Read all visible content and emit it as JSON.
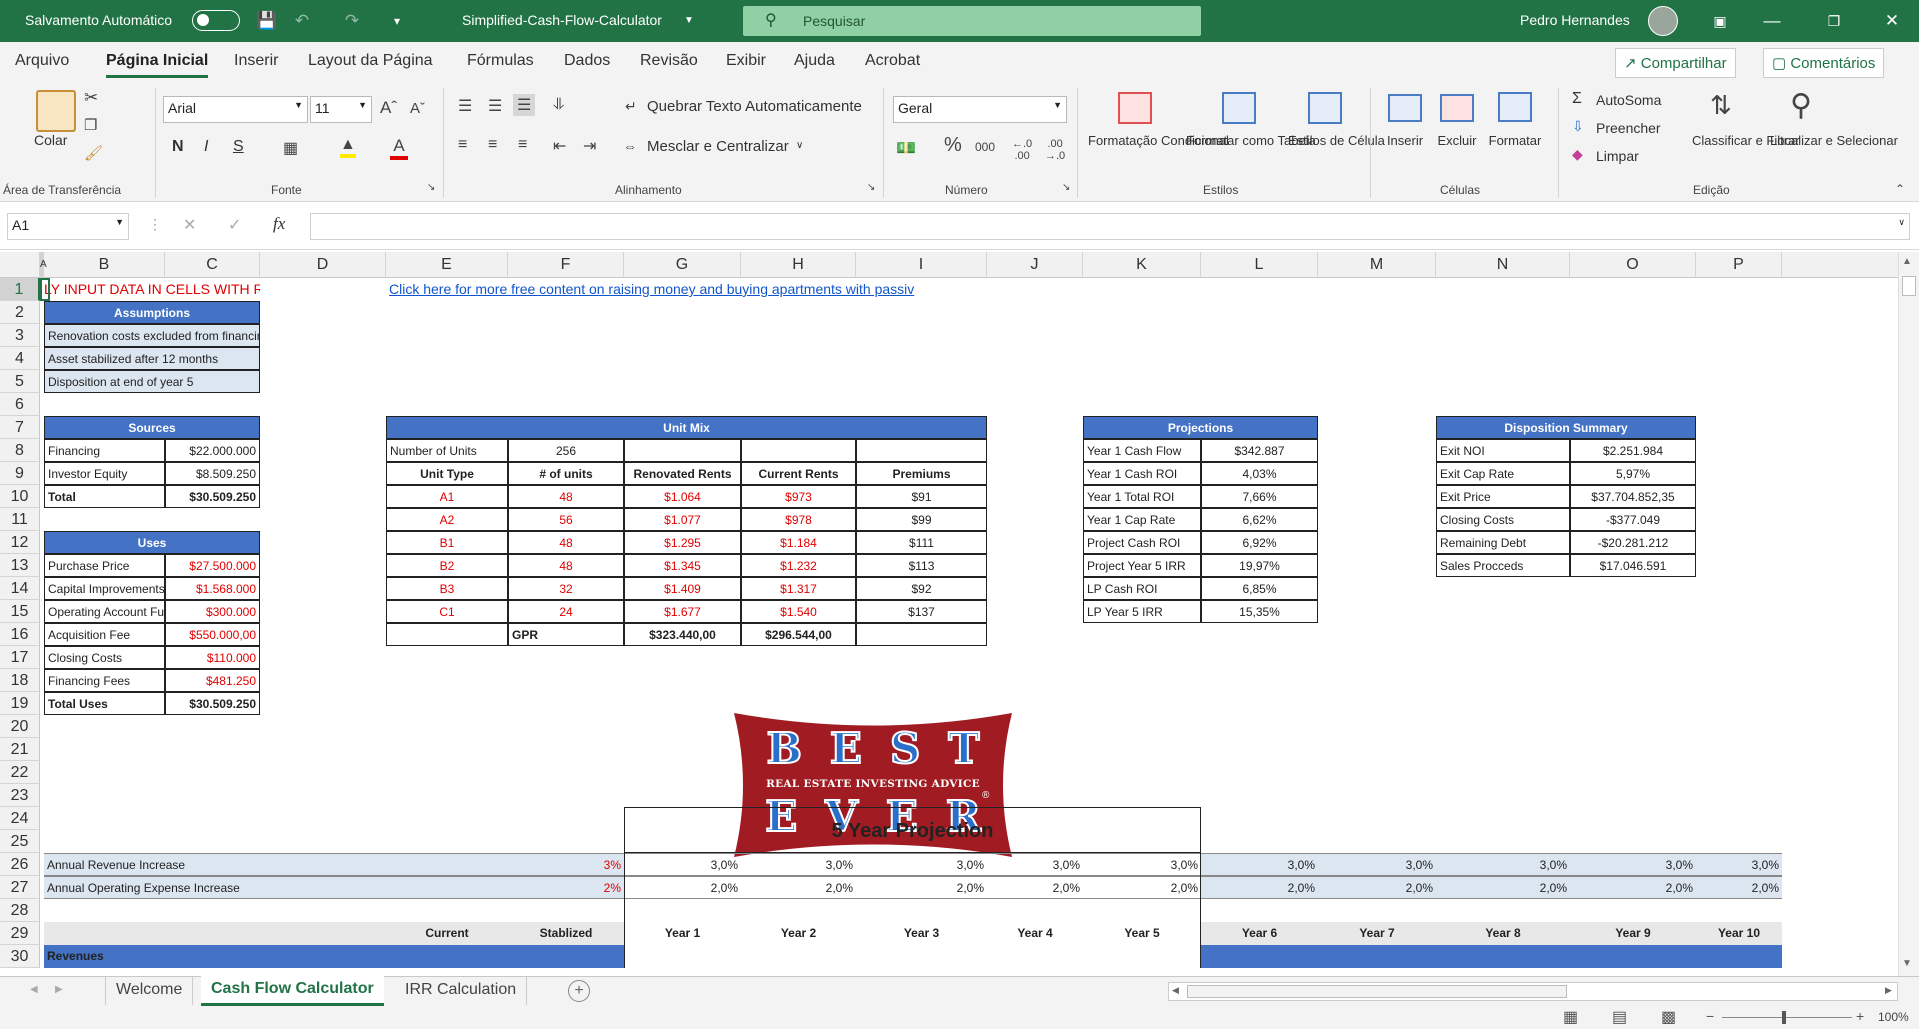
{
  "titlebar": {
    "autosave": "Salvamento Automático",
    "filename": "Simplified-Cash-Flow-Calculator",
    "search_placeholder": "Pesquisar",
    "user": "Pedro Hernandes"
  },
  "menu": {
    "tabs": [
      "Arquivo",
      "Página Inicial",
      "Inserir",
      "Layout da Página",
      "Fórmulas",
      "Dados",
      "Revisão",
      "Exibir",
      "Ajuda",
      "Acrobat"
    ],
    "share": "Compartilhar",
    "comments": "Comentários"
  },
  "ribbon": {
    "paste": "Colar",
    "clipboard_group": "Área de Transferência",
    "font_name": "Arial",
    "font_size": "11",
    "bold": "N",
    "italic": "I",
    "underline": "S",
    "font_group": "Fonte",
    "wrap_text": "Quebrar Texto Automaticamente",
    "merge_center": "Mesclar e Centralizar",
    "alignment_group": "Alinhamento",
    "number_format": "Geral",
    "number_group": "Número",
    "cond_format": "Formatação Condicional",
    "format_table": "Formatar como Tabela",
    "cell_styles": "Estilos de Célula",
    "styles_group": "Estilos",
    "insert": "Inserir",
    "delete": "Excluir",
    "format": "Formatar",
    "cells_group": "Células",
    "autosum": "AutoSoma",
    "fill": "Preencher",
    "clear": "Limpar",
    "sort_filter": "Classificar e Filtrar",
    "find_select": "Localizar e Selecionar",
    "editing_group": "Edição"
  },
  "formula_bar": {
    "name_box": "A1",
    "fx": "fx",
    "formula": ""
  },
  "columns": [
    "A",
    "B",
    "C",
    "D",
    "E",
    "F",
    "G",
    "H",
    "I",
    "J",
    "K",
    "L",
    "M",
    "N",
    "O",
    "P"
  ],
  "rows": [
    "1",
    "2",
    "3",
    "4",
    "5",
    "6",
    "7",
    "8",
    "9",
    "10",
    "11",
    "12",
    "13",
    "14",
    "15",
    "16",
    "17",
    "18",
    "19",
    "20",
    "21",
    "22",
    "23",
    "24",
    "25",
    "26",
    "27",
    "28",
    "29",
    "30"
  ],
  "sheet": {
    "a1_warning": "LY INPUT DATA IN CELLS WITH RED FO",
    "link": "Click here for more free content on raising money and buying apartments with passiv",
    "assumptions": {
      "title": "Assumptions",
      "items": [
        "Renovation costs excluded from financing",
        "Asset stabilized after 12 months",
        "Disposition at end of year 5"
      ]
    },
    "sources": {
      "title": "Sources",
      "rows": [
        [
          "Financing",
          "$22.000.000"
        ],
        [
          "Investor Equity",
          "$8.509.250"
        ],
        [
          "Total",
          "$30.509.250"
        ]
      ]
    },
    "uses": {
      "title": "Uses",
      "rows": [
        [
          "Purchase Price",
          "$27.500.000"
        ],
        [
          "Capital Improvements",
          "$1.568.000"
        ],
        [
          "Operating Account Funding",
          "$300.000"
        ],
        [
          "Acquisition Fee",
          "$550.000,00"
        ],
        [
          "Closing Costs",
          "$110.000"
        ],
        [
          "Financing Fees",
          "$481.250"
        ],
        [
          "Total Uses",
          "$30.509.250"
        ]
      ]
    },
    "unit_mix": {
      "title": "Unit Mix",
      "num_units_label": "Number of Units",
      "num_units": "256",
      "headers": [
        "Unit Type",
        "# of units",
        "Renovated  Rents",
        "Current  Rents",
        "Premiums"
      ],
      "rows": [
        [
          "A1",
          "48",
          "$1.064",
          "$973",
          "$91"
        ],
        [
          "A2",
          "56",
          "$1.077",
          "$978",
          "$99"
        ],
        [
          "B1",
          "48",
          "$1.295",
          "$1.184",
          "$111"
        ],
        [
          "B2",
          "48",
          "$1.345",
          "$1.232",
          "$113"
        ],
        [
          "B3",
          "32",
          "$1.409",
          "$1.317",
          "$92"
        ],
        [
          "C1",
          "24",
          "$1.677",
          "$1.540",
          "$137"
        ]
      ],
      "gpr_label": "GPR",
      "gpr_renovated": "$323.440,00",
      "gpr_current": "$296.544,00"
    },
    "projections": {
      "title": "Projections",
      "rows": [
        [
          "Year 1 Cash Flow",
          "$342.887"
        ],
        [
          "Year 1 Cash ROI",
          "4,03%"
        ],
        [
          "Year 1 Total ROI",
          "7,66%"
        ],
        [
          "Year 1 Cap Rate",
          "6,62%"
        ],
        [
          "Project Cash ROI",
          "6,92%"
        ],
        [
          "Project Year 5 IRR",
          "19,97%"
        ],
        [
          "LP Cash ROI",
          "6,85%"
        ],
        [
          "LP Year 5 IRR",
          "15,35%"
        ]
      ]
    },
    "disposition": {
      "title": "Disposition Summary",
      "rows": [
        [
          "Exit NOI",
          "$2.251.984"
        ],
        [
          "Exit Cap Rate",
          "5,97%"
        ],
        [
          "Exit Price",
          "$37.704.852,35"
        ],
        [
          "Closing Costs",
          "-$377.049"
        ],
        [
          "Remaining Debt",
          "-$20.281.212"
        ],
        [
          "Sales Procceds",
          "$17.046.591"
        ]
      ]
    },
    "logo": {
      "line1": "BEST",
      "tagline": "REAL ESTATE INVESTING ADVICE",
      "line2": "EVER",
      "reg": "®"
    },
    "projection_title": "5 Year Projection",
    "revenue_increase": {
      "label": "Annual Revenue Increase",
      "input": "3%",
      "values": [
        "3,0%",
        "3,0%",
        "3,0%",
        "3,0%",
        "3,0%",
        "3,0%",
        "3,0%",
        "3,0%",
        "3,0%",
        "3,0%"
      ]
    },
    "expense_increase": {
      "label": "Annual Operating Expense Increase",
      "input": "2%",
      "values": [
        "2,0%",
        "2,0%",
        "2,0%",
        "2,0%",
        "2,0%",
        "2,0%",
        "2,0%",
        "2,0%",
        "2,0%",
        "2,0%"
      ]
    },
    "period_headers": [
      "Current",
      "Stablized",
      "Year 1",
      "Year 2",
      "Year 3",
      "Year 4",
      "Year 5",
      "Year 6",
      "Year 7",
      "Year 8",
      "Year 9",
      "Year 10"
    ],
    "revenues": "Revenues"
  },
  "sheet_tabs": [
    "Welcome",
    "Cash Flow Calculator",
    "IRR Calculation"
  ],
  "status": {
    "zoom": "100%"
  },
  "colors": {
    "excel_green": "#217346",
    "header_blue": "#4472c4",
    "light_blue": "#dce6f1",
    "input_red": "#e00000",
    "logo_red": "#a01c22",
    "logo_blue": "#2a6fc9"
  }
}
